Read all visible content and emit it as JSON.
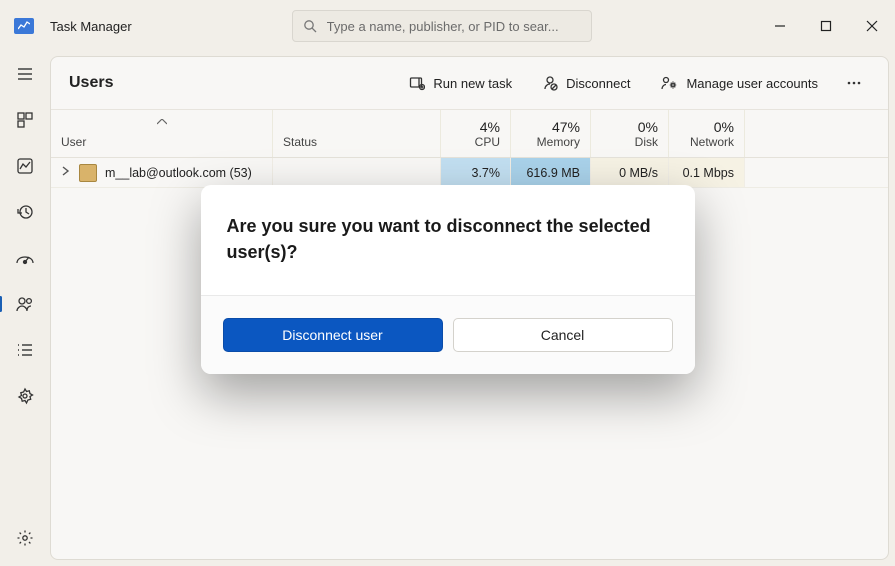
{
  "app": {
    "title": "Task Manager"
  },
  "search": {
    "placeholder": "Type a name, publisher, or PID to sear..."
  },
  "page": {
    "title": "Users",
    "toolbar": {
      "run_new_task": "Run new task",
      "disconnect": "Disconnect",
      "manage_accounts": "Manage user accounts"
    }
  },
  "columns": {
    "user_label": "User",
    "status_label": "Status",
    "cpu": {
      "percent": "4%",
      "label": "CPU"
    },
    "memory": {
      "percent": "47%",
      "label": "Memory"
    },
    "disk": {
      "percent": "0%",
      "label": "Disk"
    },
    "network": {
      "percent": "0%",
      "label": "Network"
    }
  },
  "rows": [
    {
      "user": "m__lab@outlook.com (53)",
      "status": "",
      "cpu": "3.7%",
      "memory": "616.9 MB",
      "disk": "0 MB/s",
      "network": "0.1 Mbps"
    }
  ],
  "dialog": {
    "message": "Are you sure you want to disconnect the selected user(s)?",
    "primary": "Disconnect user",
    "secondary": "Cancel"
  },
  "sidebar_icons": {
    "menu": "menu-icon",
    "processes": "processes-icon",
    "performance": "performance-icon",
    "history": "history-icon",
    "startup": "startup-icon",
    "users": "users-icon",
    "details": "details-icon",
    "services": "services-icon",
    "settings": "settings-icon"
  }
}
